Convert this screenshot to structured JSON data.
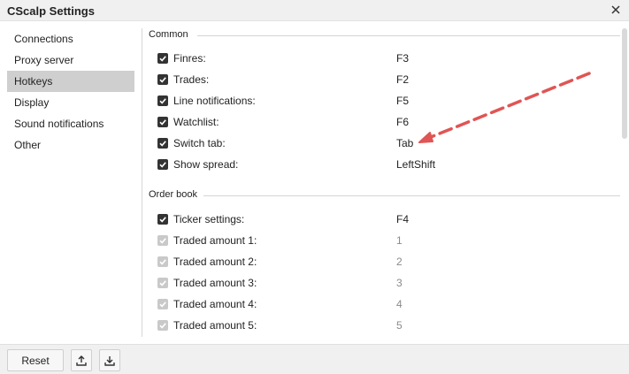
{
  "window": {
    "title": "CScalp Settings",
    "close_icon": "close-icon"
  },
  "sidebar": {
    "items": [
      {
        "label": "Connections"
      },
      {
        "label": "Proxy server"
      },
      {
        "label": "Hotkeys"
      },
      {
        "label": "Display"
      },
      {
        "label": "Sound notifications"
      },
      {
        "label": "Other"
      }
    ],
    "selected": "Hotkeys"
  },
  "sections": {
    "common": {
      "title": "Common",
      "rows": [
        {
          "label": "Finres:",
          "key": "F3",
          "checked": true
        },
        {
          "label": "Trades:",
          "key": "F2",
          "checked": true
        },
        {
          "label": "Line notifications:",
          "key": "F5",
          "checked": true
        },
        {
          "label": "Watchlist:",
          "key": "F6",
          "checked": true
        },
        {
          "label": "Switch tab:",
          "key": "Tab",
          "checked": true
        },
        {
          "label": "Show spread:",
          "key": "LeftShift",
          "checked": true
        }
      ]
    },
    "order_book": {
      "title": "Order book",
      "rows": [
        {
          "label": "Ticker settings:",
          "key": "F4",
          "checked": true,
          "disabled": false
        },
        {
          "label": "Traded amount 1:",
          "key": "1",
          "checked": true,
          "disabled": true
        },
        {
          "label": "Traded amount 2:",
          "key": "2",
          "checked": true,
          "disabled": true
        },
        {
          "label": "Traded amount 3:",
          "key": "3",
          "checked": true,
          "disabled": true
        },
        {
          "label": "Traded amount 4:",
          "key": "4",
          "checked": true,
          "disabled": true
        },
        {
          "label": "Traded amount 5:",
          "key": "5",
          "checked": true,
          "disabled": true
        }
      ]
    }
  },
  "footer": {
    "reset_label": "Reset",
    "export_icon": "upload-icon",
    "import_icon": "download-icon"
  },
  "colors": {
    "annotation_arrow": "#e05555",
    "selected_item": "#cfcfcf",
    "checkbox": "#333333"
  }
}
